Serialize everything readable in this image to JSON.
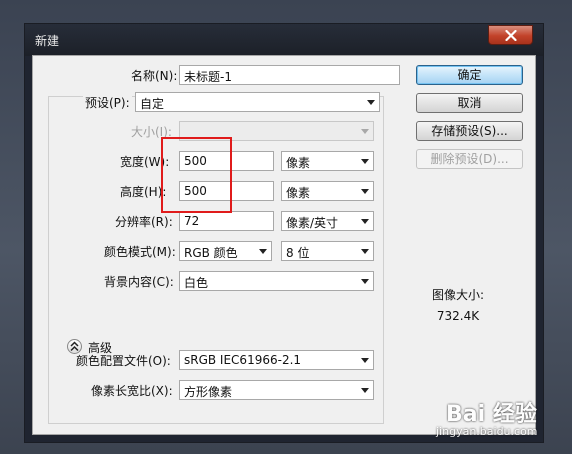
{
  "window": {
    "title": "新建"
  },
  "form": {
    "name_label": "名称(N):",
    "name_value": "未标题-1",
    "preset_label": "预设(P):",
    "preset_value": "自定",
    "size_label": "大小(I):",
    "size_value": "",
    "width_label": "宽度(W):",
    "width_value": "500",
    "width_unit": "像素",
    "height_label": "高度(H):",
    "height_value": "500",
    "height_unit": "像素",
    "resolution_label": "分辨率(R):",
    "resolution_value": "72",
    "resolution_unit": "像素/英寸",
    "color_mode_label": "颜色模式(M):",
    "color_mode_value": "RGB 颜色",
    "bit_depth_value": "8 位",
    "background_label": "背景内容(C):",
    "background_value": "白色",
    "advanced_label": "高级",
    "color_profile_label": "颜色配置文件(O):",
    "color_profile_value": "sRGB IEC61966-2.1",
    "pixel_aspect_label": "像素长宽比(X):",
    "pixel_aspect_value": "方形像素"
  },
  "buttons": {
    "ok": "确定",
    "cancel": "取消",
    "save_preset": "存储预设(S)...",
    "delete_preset": "删除预设(D)..."
  },
  "info": {
    "image_size_label": "图像大小:",
    "image_size_value": "732.4K"
  },
  "watermark": {
    "brand": "Bai 经验",
    "url": "jingyan.baidu.com"
  },
  "icons": {
    "close": "close-icon",
    "dropdown": "chevron-down-icon",
    "advanced": "double-chevron-up-icon"
  },
  "colors": {
    "highlight": "#e01b1b",
    "close_button": "#c2422a",
    "primary_button": "#c1e2f8"
  }
}
